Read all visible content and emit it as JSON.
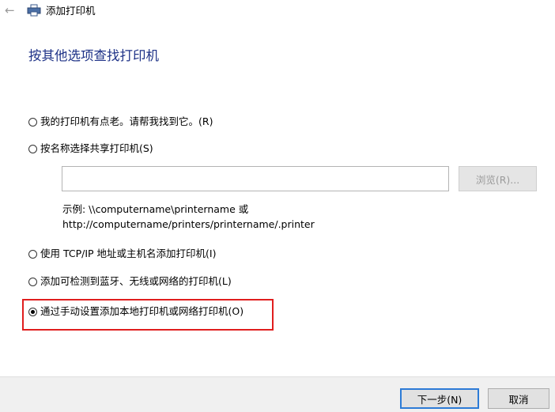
{
  "window": {
    "title": "添加打印机",
    "back_icon": "back-arrow-icon",
    "app_icon": "printer-icon"
  },
  "page": {
    "heading": "按其他选项查找打印机"
  },
  "options": [
    {
      "label": "我的打印机有点老。请帮我找到它。(R)",
      "selected": false
    },
    {
      "label": "按名称选择共享打印机(S)",
      "selected": false
    },
    {
      "label": "使用 TCP/IP 地址或主机名添加打印机(I)",
      "selected": false
    },
    {
      "label": "添加可检测到蓝牙、无线或网络的打印机(L)",
      "selected": false
    },
    {
      "label": "通过手动设置添加本地打印机或网络打印机(O)",
      "selected": true
    }
  ],
  "share": {
    "input_value": "",
    "browse_label": "浏览(R)...",
    "example_line1": "示例: \\\\computername\\printername 或",
    "example_line2": "http://computername/printers/printername/.printer"
  },
  "footer": {
    "next_label": "下一步(N)",
    "cancel_label": "取消"
  },
  "colors": {
    "heading": "#1e3287",
    "highlight": "#e01e1e",
    "focus_border": "#2d7bd6"
  }
}
